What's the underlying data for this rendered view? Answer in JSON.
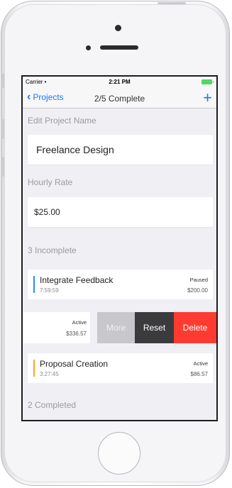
{
  "status_bar": {
    "carrier": "Carrier •",
    "time": "2:21 PM"
  },
  "nav": {
    "back_label": "Projects",
    "title": "2/5 Complete",
    "add_icon": "plus-icon"
  },
  "project": {
    "name_label": "Edit Project Name",
    "name_value": "Freelance Design",
    "rate_label": "Hourly Rate",
    "rate_value": "$25.00"
  },
  "incomplete_header": "3 Incomplete",
  "tasks": [
    {
      "name": "Integrate Feedback",
      "elapsed": "7:59:59",
      "status": "Paused",
      "amount": "$200.00",
      "color": "#2a8cf0"
    },
    {
      "name": "",
      "elapsed": "",
      "status": "Active",
      "amount": "$336.57",
      "color": "#ffffff"
    },
    {
      "name": "Proposal Creation",
      "elapsed": "3:27:45",
      "status": "Active",
      "amount": "$86.57",
      "color": "#f5a623"
    }
  ],
  "swipe_actions": {
    "more": "More",
    "reset": "Reset",
    "delete": "Delete"
  },
  "completed_header": "2 Completed",
  "colors": {
    "accent": "#1a7af5",
    "delete": "#fe3b30",
    "reset": "#3b3b3d",
    "more": "#c7c7cc"
  }
}
